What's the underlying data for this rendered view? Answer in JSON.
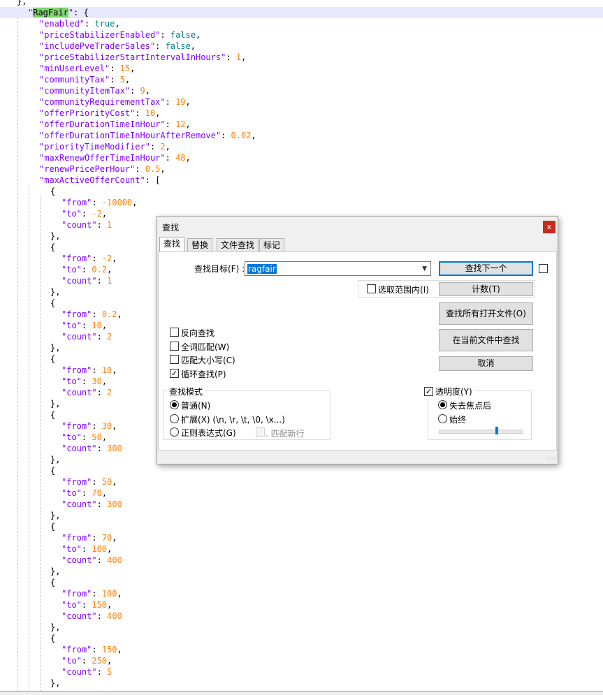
{
  "editor": {
    "lines": [
      [
        [
          "p",
          "},"
        ]
      ],
      [
        [
          "k",
          "\""
        ],
        [
          "mark",
          "RagFair"
        ],
        [
          "k",
          "\""
        ],
        [
          "p",
          ": {"
        ]
      ],
      [
        [
          "k",
          "\"enabled\""
        ],
        [
          "p",
          ": "
        ],
        [
          "b",
          "true"
        ],
        [
          "p",
          ","
        ]
      ],
      [
        [
          "k",
          "\"priceStabilizerEnabled\""
        ],
        [
          "p",
          ": "
        ],
        [
          "b",
          "false"
        ],
        [
          "p",
          ","
        ]
      ],
      [
        [
          "k",
          "\"includePveTraderSales\""
        ],
        [
          "p",
          ": "
        ],
        [
          "b",
          "false"
        ],
        [
          "p",
          ","
        ]
      ],
      [
        [
          "k",
          "\"priceStabilizerStartIntervalInHours\""
        ],
        [
          "p",
          ": "
        ],
        [
          "n",
          "1"
        ],
        [
          "p",
          ","
        ]
      ],
      [
        [
          "k",
          "\"minUserLevel\""
        ],
        [
          "p",
          ": "
        ],
        [
          "n",
          "15"
        ],
        [
          "p",
          ","
        ]
      ],
      [
        [
          "k",
          "\"communityTax\""
        ],
        [
          "p",
          ": "
        ],
        [
          "n",
          "5"
        ],
        [
          "p",
          ","
        ]
      ],
      [
        [
          "k",
          "\"communityItemTax\""
        ],
        [
          "p",
          ": "
        ],
        [
          "n",
          "9"
        ],
        [
          "p",
          ","
        ]
      ],
      [
        [
          "k",
          "\"communityRequirementTax\""
        ],
        [
          "p",
          ": "
        ],
        [
          "n",
          "19"
        ],
        [
          "p",
          ","
        ]
      ],
      [
        [
          "k",
          "\"offerPriorityCost\""
        ],
        [
          "p",
          ": "
        ],
        [
          "n",
          "10"
        ],
        [
          "p",
          ","
        ]
      ],
      [
        [
          "k",
          "\"offerDurationTimeInHour\""
        ],
        [
          "p",
          ": "
        ],
        [
          "n",
          "12"
        ],
        [
          "p",
          ","
        ]
      ],
      [
        [
          "k",
          "\"offerDurationTimeInHourAfterRemove\""
        ],
        [
          "p",
          ": "
        ],
        [
          "n",
          "0.02"
        ],
        [
          "p",
          ","
        ]
      ],
      [
        [
          "k",
          "\"priorityTimeModifier\""
        ],
        [
          "p",
          ": "
        ],
        [
          "n",
          "2"
        ],
        [
          "p",
          ","
        ]
      ],
      [
        [
          "k",
          "\"maxRenewOfferTimeInHour\""
        ],
        [
          "p",
          ": "
        ],
        [
          "n",
          "48"
        ],
        [
          "p",
          ","
        ]
      ],
      [
        [
          "k",
          "\"renewPricePerHour\""
        ],
        [
          "p",
          ": "
        ],
        [
          "n",
          "0.5"
        ],
        [
          "p",
          ","
        ]
      ],
      [
        [
          "k",
          "\"maxActiveOfferCount\""
        ],
        [
          "p",
          ": ["
        ]
      ],
      [
        [
          "p",
          "{"
        ]
      ],
      [
        [
          "k",
          "\"from\""
        ],
        [
          "p",
          ": "
        ],
        [
          "n",
          "-10000"
        ],
        [
          "p",
          ","
        ]
      ],
      [
        [
          "k",
          "\"to\""
        ],
        [
          "p",
          ": "
        ],
        [
          "n",
          "-2"
        ],
        [
          "p",
          ","
        ]
      ],
      [
        [
          "k",
          "\"count\""
        ],
        [
          "p",
          ": "
        ],
        [
          "n",
          "1"
        ]
      ],
      [
        [
          "p",
          "},"
        ]
      ],
      [
        [
          "p",
          "{"
        ]
      ],
      [
        [
          "k",
          "\"from\""
        ],
        [
          "p",
          ": "
        ],
        [
          "n",
          "-2"
        ],
        [
          "p",
          ","
        ]
      ],
      [
        [
          "k",
          "\"to\""
        ],
        [
          "p",
          ": "
        ],
        [
          "n",
          "0.2"
        ],
        [
          "p",
          ","
        ]
      ],
      [
        [
          "k",
          "\"count\""
        ],
        [
          "p",
          ": "
        ],
        [
          "n",
          "1"
        ]
      ],
      [
        [
          "p",
          "},"
        ]
      ],
      [
        [
          "p",
          "{"
        ]
      ],
      [
        [
          "k",
          "\"from\""
        ],
        [
          "p",
          ": "
        ],
        [
          "n",
          "0.2"
        ],
        [
          "p",
          ","
        ]
      ],
      [
        [
          "k",
          "\"to\""
        ],
        [
          "p",
          ": "
        ],
        [
          "n",
          "10"
        ],
        [
          "p",
          ","
        ]
      ],
      [
        [
          "k",
          "\"count\""
        ],
        [
          "p",
          ": "
        ],
        [
          "n",
          "2"
        ]
      ],
      [
        [
          "p",
          "},"
        ]
      ],
      [
        [
          "p",
          "{"
        ]
      ],
      [
        [
          "k",
          "\"from\""
        ],
        [
          "p",
          ": "
        ],
        [
          "n",
          "10"
        ],
        [
          "p",
          ","
        ]
      ],
      [
        [
          "k",
          "\"to\""
        ],
        [
          "p",
          ": "
        ],
        [
          "n",
          "30"
        ],
        [
          "p",
          ","
        ]
      ],
      [
        [
          "k",
          "\"count\""
        ],
        [
          "p",
          ": "
        ],
        [
          "n",
          "2"
        ]
      ],
      [
        [
          "p",
          "},"
        ]
      ],
      [
        [
          "p",
          "{"
        ]
      ],
      [
        [
          "k",
          "\"from\""
        ],
        [
          "p",
          ": "
        ],
        [
          "n",
          "30"
        ],
        [
          "p",
          ","
        ]
      ],
      [
        [
          "k",
          "\"to\""
        ],
        [
          "p",
          ": "
        ],
        [
          "n",
          "50"
        ],
        [
          "p",
          ","
        ]
      ],
      [
        [
          "k",
          "\"count\""
        ],
        [
          "p",
          ": "
        ],
        [
          "n",
          "300"
        ]
      ],
      [
        [
          "p",
          "},"
        ]
      ],
      [
        [
          "p",
          "{"
        ]
      ],
      [
        [
          "k",
          "\"from\""
        ],
        [
          "p",
          ": "
        ],
        [
          "n",
          "50"
        ],
        [
          "p",
          ","
        ]
      ],
      [
        [
          "k",
          "\"to\""
        ],
        [
          "p",
          ": "
        ],
        [
          "n",
          "70"
        ],
        [
          "p",
          ","
        ]
      ],
      [
        [
          "k",
          "\"count\""
        ],
        [
          "p",
          ": "
        ],
        [
          "n",
          "300"
        ]
      ],
      [
        [
          "p",
          "},"
        ]
      ],
      [
        [
          "p",
          "{"
        ]
      ],
      [
        [
          "k",
          "\"from\""
        ],
        [
          "p",
          ": "
        ],
        [
          "n",
          "70"
        ],
        [
          "p",
          ","
        ]
      ],
      [
        [
          "k",
          "\"to\""
        ],
        [
          "p",
          ": "
        ],
        [
          "n",
          "100"
        ],
        [
          "p",
          ","
        ]
      ],
      [
        [
          "k",
          "\"count\""
        ],
        [
          "p",
          ": "
        ],
        [
          "n",
          "400"
        ]
      ],
      [
        [
          "p",
          "},"
        ]
      ],
      [
        [
          "p",
          "{"
        ]
      ],
      [
        [
          "k",
          "\"from\""
        ],
        [
          "p",
          ": "
        ],
        [
          "n",
          "100"
        ],
        [
          "p",
          ","
        ]
      ],
      [
        [
          "k",
          "\"to\""
        ],
        [
          "p",
          ": "
        ],
        [
          "n",
          "150"
        ],
        [
          "p",
          ","
        ]
      ],
      [
        [
          "k",
          "\"count\""
        ],
        [
          "p",
          ": "
        ],
        [
          "n",
          "400"
        ]
      ],
      [
        [
          "p",
          "},"
        ]
      ],
      [
        [
          "p",
          "{"
        ]
      ],
      [
        [
          "k",
          "\"from\""
        ],
        [
          "p",
          ": "
        ],
        [
          "n",
          "150"
        ],
        [
          "p",
          ","
        ]
      ],
      [
        [
          "k",
          "\"to\""
        ],
        [
          "p",
          ": "
        ],
        [
          "n",
          "250"
        ],
        [
          "p",
          ","
        ]
      ],
      [
        [
          "k",
          "\"count\""
        ],
        [
          "p",
          ": "
        ],
        [
          "n",
          "5"
        ]
      ],
      [
        [
          "p",
          "},"
        ]
      ]
    ]
  },
  "dialog": {
    "title": "查找",
    "close_label": "x",
    "tabs": [
      "查找",
      "替换",
      "文件查找",
      "标记"
    ],
    "find_label": "查找目标(F) :",
    "find_value": "ragfair",
    "buttons": {
      "find_next": "查找下一个",
      "count": "计数(T)",
      "find_all_open": "查找所有打开文件(O)",
      "find_in_current": "在当前文件中查找",
      "cancel": "取消"
    },
    "in_selection_label": "选取范围内(I)",
    "options": [
      {
        "label": "反向查找",
        "checked": false
      },
      {
        "label": "全词匹配(W)",
        "checked": false
      },
      {
        "label": "匹配大小写(C)",
        "checked": false
      },
      {
        "label": "循环查找(P)",
        "checked": true
      }
    ],
    "search_mode": {
      "title": "查找模式",
      "normal": "普通(N)",
      "extended": "扩展(X) (\\n, \\r, \\t, \\0, \\x...)",
      "regex": "正则表达式(G)",
      "match_newline": ". 匹配新行",
      "selected": "normal"
    },
    "transparency": {
      "title": "透明度(Y)",
      "enabled": true,
      "on_lose_focus": "失去焦点后",
      "always": "始终",
      "selected": "on_lose_focus",
      "level": 0.7
    }
  }
}
